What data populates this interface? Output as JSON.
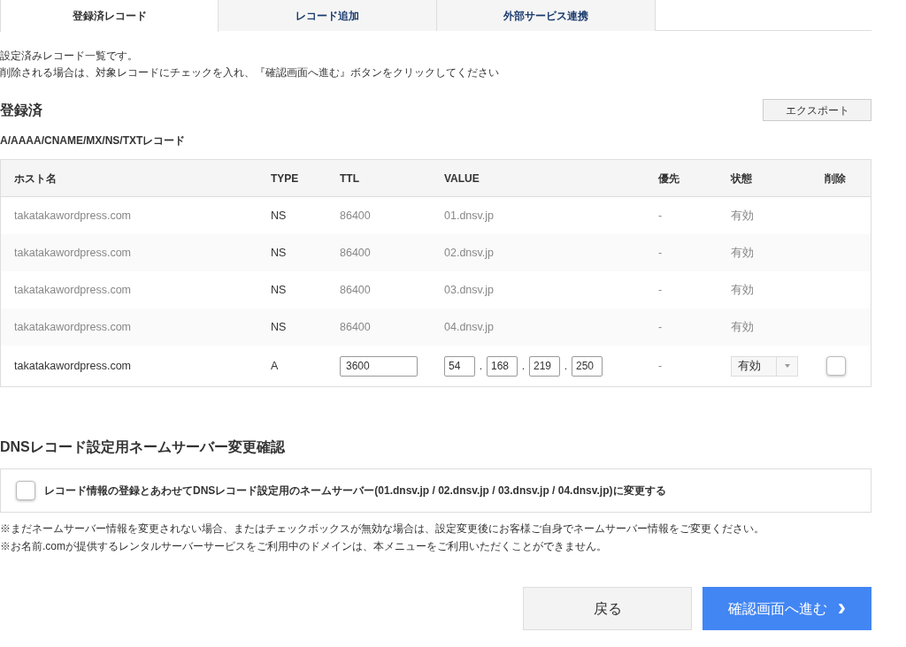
{
  "tabs": [
    {
      "label": "登録済レコード",
      "selected": true
    },
    {
      "label": "レコード追加",
      "selected": false
    },
    {
      "label": "外部サービス連携",
      "selected": false
    }
  ],
  "intro": [
    "設定済みレコード一覧です。",
    "削除される場合は、対象レコードにチェックを入れ、『確認画面へ進む』ボタンをクリックしてください"
  ],
  "section_title": "登録済",
  "export_button": "エクスポート",
  "record_types": "A/AAAA/CNAME/MX/NS/TXTレコード",
  "table": {
    "columns": [
      "ホスト名",
      "TYPE",
      "TTL",
      "VALUE",
      "優先",
      "状態",
      "削除"
    ],
    "rows": [
      {
        "kind": "static",
        "host": "takatakawordpress.com",
        "type": "NS",
        "ttl": "86400",
        "value": "01.dnsv.jp",
        "priority": "-",
        "status": "有効"
      },
      {
        "kind": "static",
        "host": "takatakawordpress.com",
        "type": "NS",
        "ttl": "86400",
        "value": "02.dnsv.jp",
        "priority": "-",
        "status": "有効"
      },
      {
        "kind": "static",
        "host": "takatakawordpress.com",
        "type": "NS",
        "ttl": "86400",
        "value": "03.dnsv.jp",
        "priority": "-",
        "status": "有効"
      },
      {
        "kind": "static",
        "host": "takatakawordpress.com",
        "type": "NS",
        "ttl": "86400",
        "value": "04.dnsv.jp",
        "priority": "-",
        "status": "有効"
      },
      {
        "kind": "editable",
        "host": "takatakawordpress.com",
        "type": "A",
        "ttl": "3600",
        "octets": [
          "54",
          "168",
          "219",
          "250"
        ],
        "octet_separator": ".",
        "priority": "-",
        "status": "有効",
        "delete_checked": false
      }
    ]
  },
  "ns_section": {
    "title": "DNSレコード設定用ネームサーバー変更確認",
    "checkbox_label": "レコード情報の登録とあわせてDNSレコード設定用のネームサーバー(01.dnsv.jp / 02.dnsv.jp / 03.dnsv.jp / 04.dnsv.jp)に変更する",
    "checked": false,
    "notes": [
      "※まだネームサーバー情報を変更されない場合、またはチェックボックスが無効な場合は、設定変更後にお客様ご自身でネームサーバー情報をご変更ください。",
      "※お名前.comが提供するレンタルサーバーサービスをご利用中のドメインは、本メニューをご利用いただくことができません。"
    ]
  },
  "buttons": {
    "back": "戻る",
    "next": "確認画面へ進む",
    "next_arrow": "›"
  }
}
